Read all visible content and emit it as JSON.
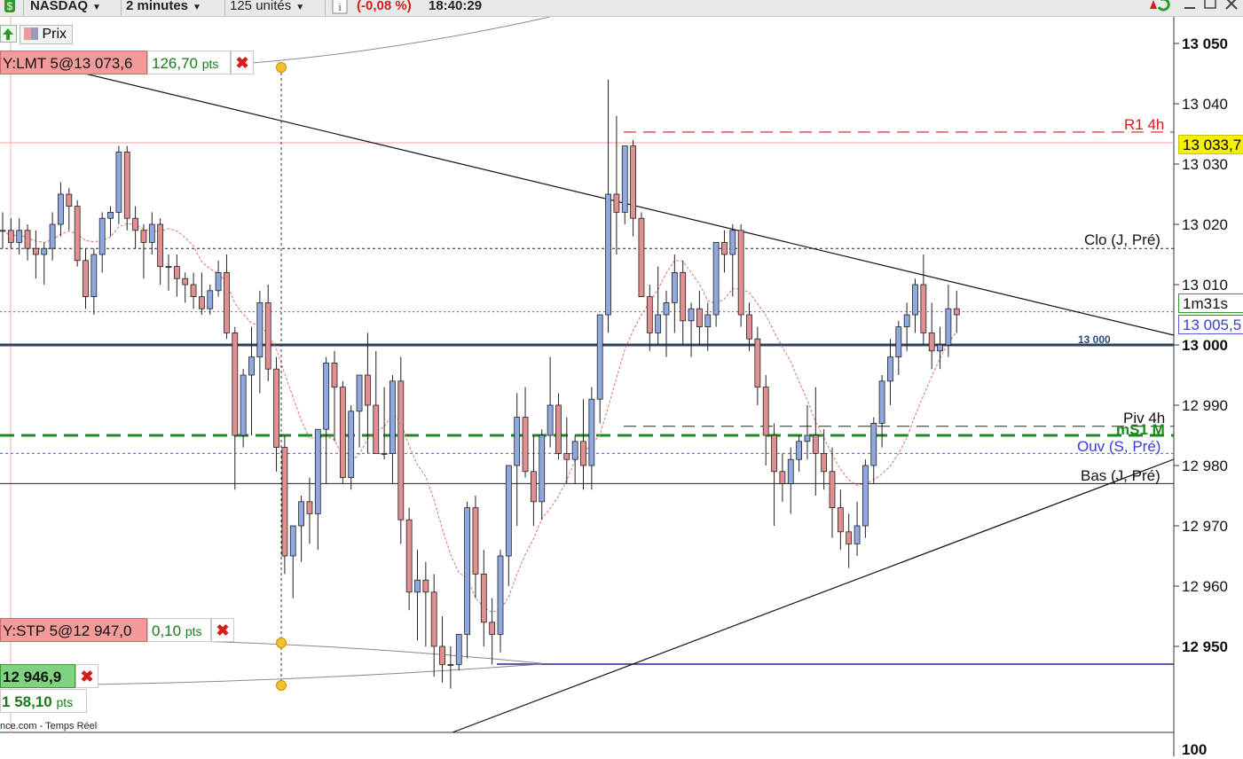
{
  "toolbar": {
    "symbol": "NASDAQ",
    "interval": "2 minutes",
    "units": "125 unités",
    "info_icon": "info-icon",
    "change": "(-0,08 %)",
    "time": "18:40:29",
    "colors": {
      "change": "#d81b1b"
    }
  },
  "legend": {
    "price_label": "Prix"
  },
  "orders": [
    {
      "label": "Y:LMT 5@13 073,6",
      "pts": "126,70",
      "unit": "pts",
      "cancel": "✖"
    },
    {
      "label": "Y:STP 5@12 947,0",
      "pts": "0,10",
      "unit": "pts",
      "cancel": "✖"
    },
    {
      "label": "12 946,9",
      "cancel": "✖"
    },
    {
      "label": "1",
      "pts": "58,10",
      "unit": "pts"
    }
  ],
  "footer": {
    "source": "nce.com - Temps Réel"
  },
  "axis": {
    "ticks": [
      "13 050",
      "13 040",
      "13 030",
      "13 020",
      "13 010",
      "13 000",
      "12 990",
      "12 980",
      "12 970",
      "12 960",
      "12 950"
    ],
    "sub_axis": "100"
  },
  "badges": {
    "last_price": "13 033,7",
    "countdown": "1m31s",
    "current": "13 005,5",
    "colors": {
      "last_price": "#f5f000",
      "countdown": "#ffffff",
      "current": "#ffffff"
    }
  },
  "levels": {
    "r1": "R1 4h",
    "close": "Clo (J, Pré)",
    "round": "13 000",
    "piv": "Piv 4h",
    "ms1": "mS1 M",
    "open": "Ouv (S, Pré)",
    "low": "Bas (J, Pré)"
  },
  "chart_data": {
    "type": "candlestick",
    "symbol": "NASDAQ",
    "interval": "2 minutes",
    "ylim": [
      12940,
      13055
    ],
    "levels": [
      {
        "name": "R1 4h",
        "value": 13035
      },
      {
        "name": "Clo (J, Pré)",
        "value": 13016
      },
      {
        "name": "13 000",
        "value": 13000
      },
      {
        "name": "Piv 4h",
        "value": 12986.5
      },
      {
        "name": "mS1 M",
        "value": 12985
      },
      {
        "name": "Ouv (S, Pré)",
        "value": 12982
      },
      {
        "name": "Bas (J, Pré)",
        "value": 12977
      },
      {
        "name": "12 947",
        "value": 12947
      }
    ],
    "candles": [
      [
        13019,
        13022,
        13016,
        13019
      ],
      [
        13019,
        13021,
        13016,
        13017
      ],
      [
        13017,
        13021,
        13015,
        13019
      ],
      [
        13019,
        13020,
        13014,
        13016
      ],
      [
        13016,
        13019,
        13011,
        13015
      ],
      [
        13015,
        13017,
        13010,
        13016
      ],
      [
        13016,
        13022,
        13014,
        13020
      ],
      [
        13020,
        13027,
        13018,
        13025
      ],
      [
        13025,
        13026,
        13019,
        13023
      ],
      [
        13023,
        13024,
        13013,
        13014
      ],
      [
        13014,
        13016,
        13006,
        13008
      ],
      [
        13008,
        13016,
        13005,
        13015
      ],
      [
        13015,
        13022,
        13012,
        13021
      ],
      [
        13021,
        13023,
        13018,
        13022
      ],
      [
        13022,
        13033,
        13020,
        13032
      ],
      [
        13032,
        13033,
        13019,
        13021
      ],
      [
        13021,
        13023,
        13016,
        13019
      ],
      [
        13019,
        13020,
        13011,
        13017
      ],
      [
        13017,
        13022,
        13015,
        13020
      ],
      [
        13020,
        13021,
        13010,
        13013
      ],
      [
        13013,
        13015,
        13009,
        13013
      ],
      [
        13013,
        13015,
        13008,
        13011
      ],
      [
        13011,
        13012,
        13007,
        13010
      ],
      [
        13010,
        13012,
        13006,
        13008
      ],
      [
        13008,
        13012,
        13005,
        13006
      ],
      [
        13006,
        13010,
        13005,
        13009
      ],
      [
        13009,
        13014,
        13008,
        13012
      ],
      [
        13012,
        13015,
        13001,
        13002
      ],
      [
        13002,
        13003,
        12976,
        12985
      ],
      [
        12985,
        12996,
        12983,
        12995
      ],
      [
        12995,
        13003,
        12985,
        12998
      ],
      [
        12998,
        13009,
        12992,
        13007
      ],
      [
        13007,
        13010,
        12994,
        12996
      ],
      [
        12996,
        12998,
        12979,
        12983
      ],
      [
        12983,
        12985,
        12962,
        12965
      ],
      [
        12965,
        12970,
        12958,
        12970
      ],
      [
        12970,
        12975,
        12964,
        12974
      ],
      [
        12974,
        12978,
        12967,
        12972
      ],
      [
        12972,
        12986,
        12966,
        12986
      ],
      [
        12986,
        12998,
        12977,
        12997
      ],
      [
        12997,
        12999,
        12984,
        12993
      ],
      [
        12993,
        12994,
        12977,
        12978
      ],
      [
        12978,
        12990,
        12976,
        12989
      ],
      [
        12989,
        12994,
        12983,
        12995
      ],
      [
        12995,
        13002,
        12982,
        12990
      ],
      [
        12990,
        12999,
        12982,
        12982
      ],
      [
        12982,
        12993,
        12981,
        12982
      ],
      [
        12982,
        12995,
        12977,
        12994
      ],
      [
        12994,
        12998,
        12967,
        12971
      ],
      [
        12971,
        12973,
        12956,
        12959
      ],
      [
        12959,
        12966,
        12951,
        12961
      ],
      [
        12961,
        12964,
        12950,
        12959
      ],
      [
        12959,
        12962,
        12945,
        12950
      ],
      [
        12950,
        12955,
        12944,
        12947
      ],
      [
        12947,
        12950,
        12943,
        12947
      ],
      [
        12947,
        12952,
        12946,
        12952
      ],
      [
        12952,
        12974,
        12948,
        12973
      ],
      [
        12973,
        12975,
        12958,
        12962
      ],
      [
        12962,
        12966,
        12950,
        12954
      ],
      [
        12954,
        12958,
        12947,
        12952
      ],
      [
        12952,
        12966,
        12949,
        12965
      ],
      [
        12965,
        12980,
        12960,
        12980
      ],
      [
        12980,
        12992,
        12970,
        12988
      ],
      [
        12988,
        12993,
        12978,
        12979
      ],
      [
        12979,
        12985,
        12970,
        12974
      ],
      [
        12974,
        12986,
        12971,
        12985
      ],
      [
        12985,
        12998,
        12983,
        12990
      ],
      [
        12990,
        12992,
        12981,
        12982
      ],
      [
        12982,
        12988,
        12977,
        12981
      ],
      [
        12981,
        12985,
        12977,
        12984
      ],
      [
        12984,
        12991,
        12976,
        12980
      ],
      [
        12980,
        12993,
        12976,
        12991
      ],
      [
        12991,
        13005,
        12987,
        13005
      ],
      [
        13005,
        13044,
        13002,
        13025
      ],
      [
        13025,
        13038,
        13015,
        13022
      ],
      [
        13022,
        13033,
        13020,
        13033
      ],
      [
        13033,
        13034,
        13018,
        13021
      ],
      [
        13021,
        13022,
        13010,
        13008
      ],
      [
        13008,
        13010,
        12999,
        13002
      ],
      [
        13002,
        13013,
        13000,
        13005
      ],
      [
        13005,
        13009,
        12998,
        13007
      ],
      [
        13007,
        13015,
        13002,
        13012
      ],
      [
        13012,
        13014,
        13000,
        13004
      ],
      [
        13004,
        13007,
        12998,
        13006
      ],
      [
        13006,
        13009,
        13000,
        13003
      ],
      [
        13003,
        13007,
        12999,
        13005
      ],
      [
        13005,
        13017,
        13003,
        13017
      ],
      [
        13017,
        13019,
        13012,
        13015
      ],
      [
        13015,
        13020,
        13008,
        13019
      ],
      [
        13019,
        13020,
        13003,
        13005
      ],
      [
        13005,
        13007,
        12999,
        13001
      ],
      [
        13001,
        13003,
        12990,
        12993
      ],
      [
        12993,
        12995,
        12980,
        12985
      ],
      [
        12985,
        12987,
        12970,
        12979
      ],
      [
        12979,
        12982,
        12974,
        12977
      ],
      [
        12977,
        12983,
        12972,
        12981
      ],
      [
        12981,
        12985,
        12979,
        12984
      ],
      [
        12984,
        12990,
        12981,
        12985
      ],
      [
        12985,
        12993,
        12975,
        12982
      ],
      [
        12982,
        12986,
        12976,
        12979
      ],
      [
        12979,
        12983,
        12968,
        12973
      ],
      [
        12973,
        12976,
        12966,
        12969
      ],
      [
        12969,
        12972,
        12963,
        12967
      ],
      [
        12967,
        12974,
        12965,
        12970
      ],
      [
        12970,
        12981,
        12968,
        12980
      ],
      [
        12980,
        12988,
        12977,
        12987
      ],
      [
        12987,
        12995,
        12983,
        12994
      ],
      [
        12994,
        13001,
        12990,
        12998
      ],
      [
        12998,
        13004,
        12995,
        13003
      ],
      [
        13003,
        13007,
        12999,
        13005
      ],
      [
        13005,
        13011,
        13002,
        13010
      ],
      [
        13010,
        13015,
        13000,
        13002
      ],
      [
        13002,
        13007,
        12996,
        12999
      ],
      [
        12999,
        13003,
        12996,
        13000
      ],
      [
        13000,
        13010,
        12998,
        13006
      ],
      [
        13006,
        13009,
        13002,
        13005
      ]
    ]
  }
}
